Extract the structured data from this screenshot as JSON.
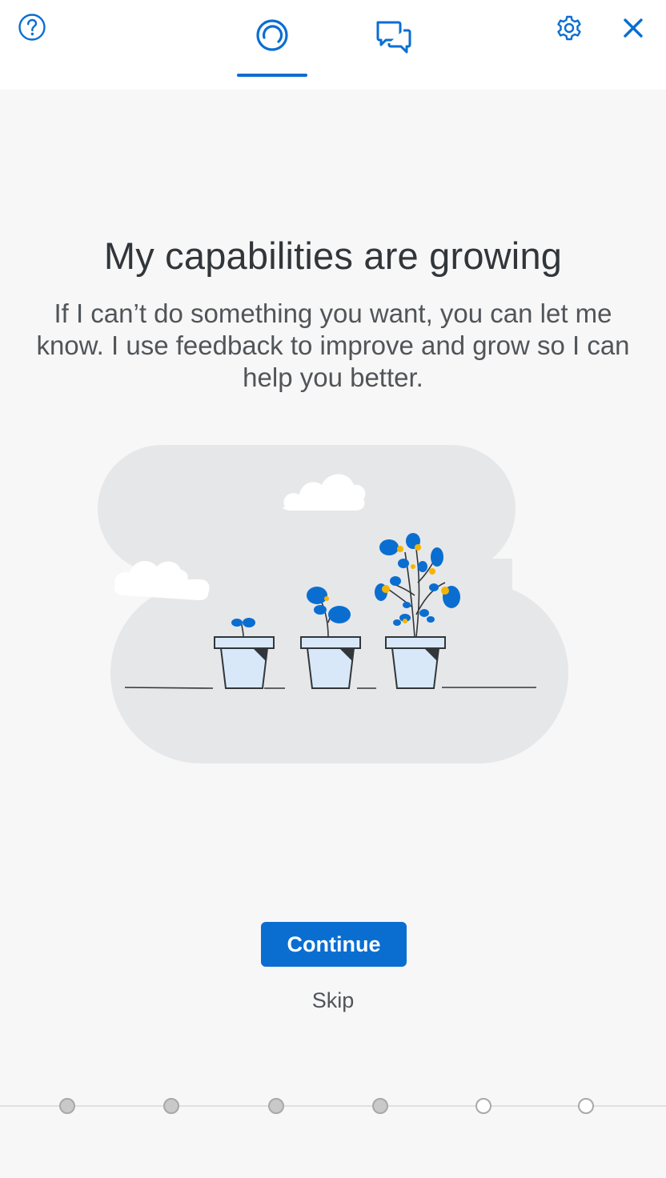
{
  "header": {
    "help_icon": "help-circle-icon",
    "settings_icon": "gear-icon",
    "close_icon": "close-icon",
    "tabs": [
      {
        "icon": "assistant-ring-icon",
        "active": true
      },
      {
        "icon": "chat-bubbles-icon",
        "active": false
      }
    ],
    "accent_color": "#0a6ed1"
  },
  "content": {
    "title": "My capabilities are growing",
    "description": "If I can’t do something you want, you can let me know. I use feedback to improve and grow so I can help you better."
  },
  "actions": {
    "continue_label": "Continue",
    "skip_label": "Skip"
  },
  "progress": {
    "total_steps": 6,
    "completed_steps": 4
  }
}
